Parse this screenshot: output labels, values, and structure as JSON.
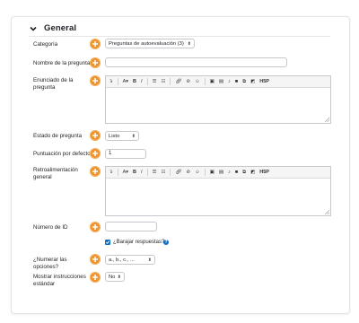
{
  "section": {
    "title": "General"
  },
  "fields": {
    "category_label": "Categoría",
    "category_value": "Preguntas de autoevaluación (3)",
    "name_label": "Nombre de la pregunta",
    "name_value": "",
    "statement_label": "Enunciado de la pregunta",
    "state_label": "Estado de pregunta",
    "state_value": "Listo",
    "default_mark_label": "Puntuación por defecto",
    "default_mark_value": "1",
    "feedback_label": "Retroalimentación general",
    "id_label": "Número de ID",
    "id_value": "",
    "shuffle_label": "¿Barajar respuestas?",
    "numbering_label": "¿Numerar las opciones?",
    "numbering_value": "a., b., c., ...",
    "instructions_label": "Mostrar instrucciones estándar",
    "instructions_value": "No"
  },
  "toolbar": {
    "collapse": "↴",
    "font": "A",
    "bold": "B",
    "italic": "I"
  },
  "colors": {
    "required": "#f0932b",
    "accent": "#0f6cbf"
  }
}
